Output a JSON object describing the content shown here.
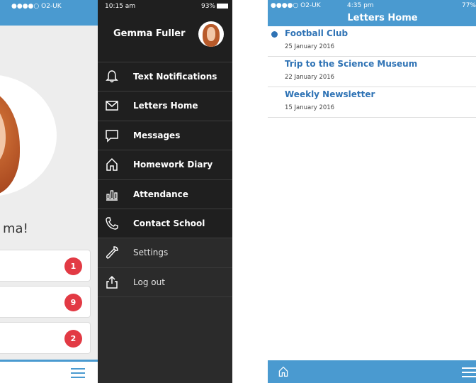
{
  "left_phone": {
    "status": {
      "carrier": "●●●●○ O2-UK"
    },
    "greeting_fragment": "ma!",
    "cards": [
      {
        "badge": "1"
      },
      {
        "badge": "9"
      },
      {
        "badge": "2"
      }
    ],
    "drawer": {
      "status": {
        "time": "10:15 am",
        "battery": "93%"
      },
      "user_name": "Gemma Fuller",
      "menu": [
        {
          "label": "Text Notifications",
          "icon": "bell-icon"
        },
        {
          "label": "Letters Home",
          "icon": "envelope-icon"
        },
        {
          "label": "Messages",
          "icon": "chat-bubble-icon"
        },
        {
          "label": "Homework Diary",
          "icon": "house-icon"
        },
        {
          "label": "Attendance",
          "icon": "bar-chart-icon"
        },
        {
          "label": "Contact School",
          "icon": "phone-icon"
        },
        {
          "label": "Settings",
          "icon": "wrench-icon"
        },
        {
          "label": "Log out",
          "icon": "share-out-icon"
        }
      ]
    },
    "colors": {
      "accent": "#4a9ad0",
      "badge": "#e23a44",
      "drawer_bg": "#2b2b2b"
    }
  },
  "right_phone": {
    "status": {
      "carrier": "●●●●○ O2-UK",
      "time": "4:35 pm",
      "battery": "77%"
    },
    "title": "Letters Home",
    "letters": [
      {
        "title": "Football Club",
        "date": "25 January 2016",
        "unread": true
      },
      {
        "title": "Trip to the Science Museum",
        "date": "22 January 2016",
        "unread": false
      },
      {
        "title": "Weekly Newsletter",
        "date": "15 January 2016",
        "unread": false
      }
    ],
    "colors": {
      "accent": "#4a9ad0",
      "link": "#2f73b5"
    }
  }
}
